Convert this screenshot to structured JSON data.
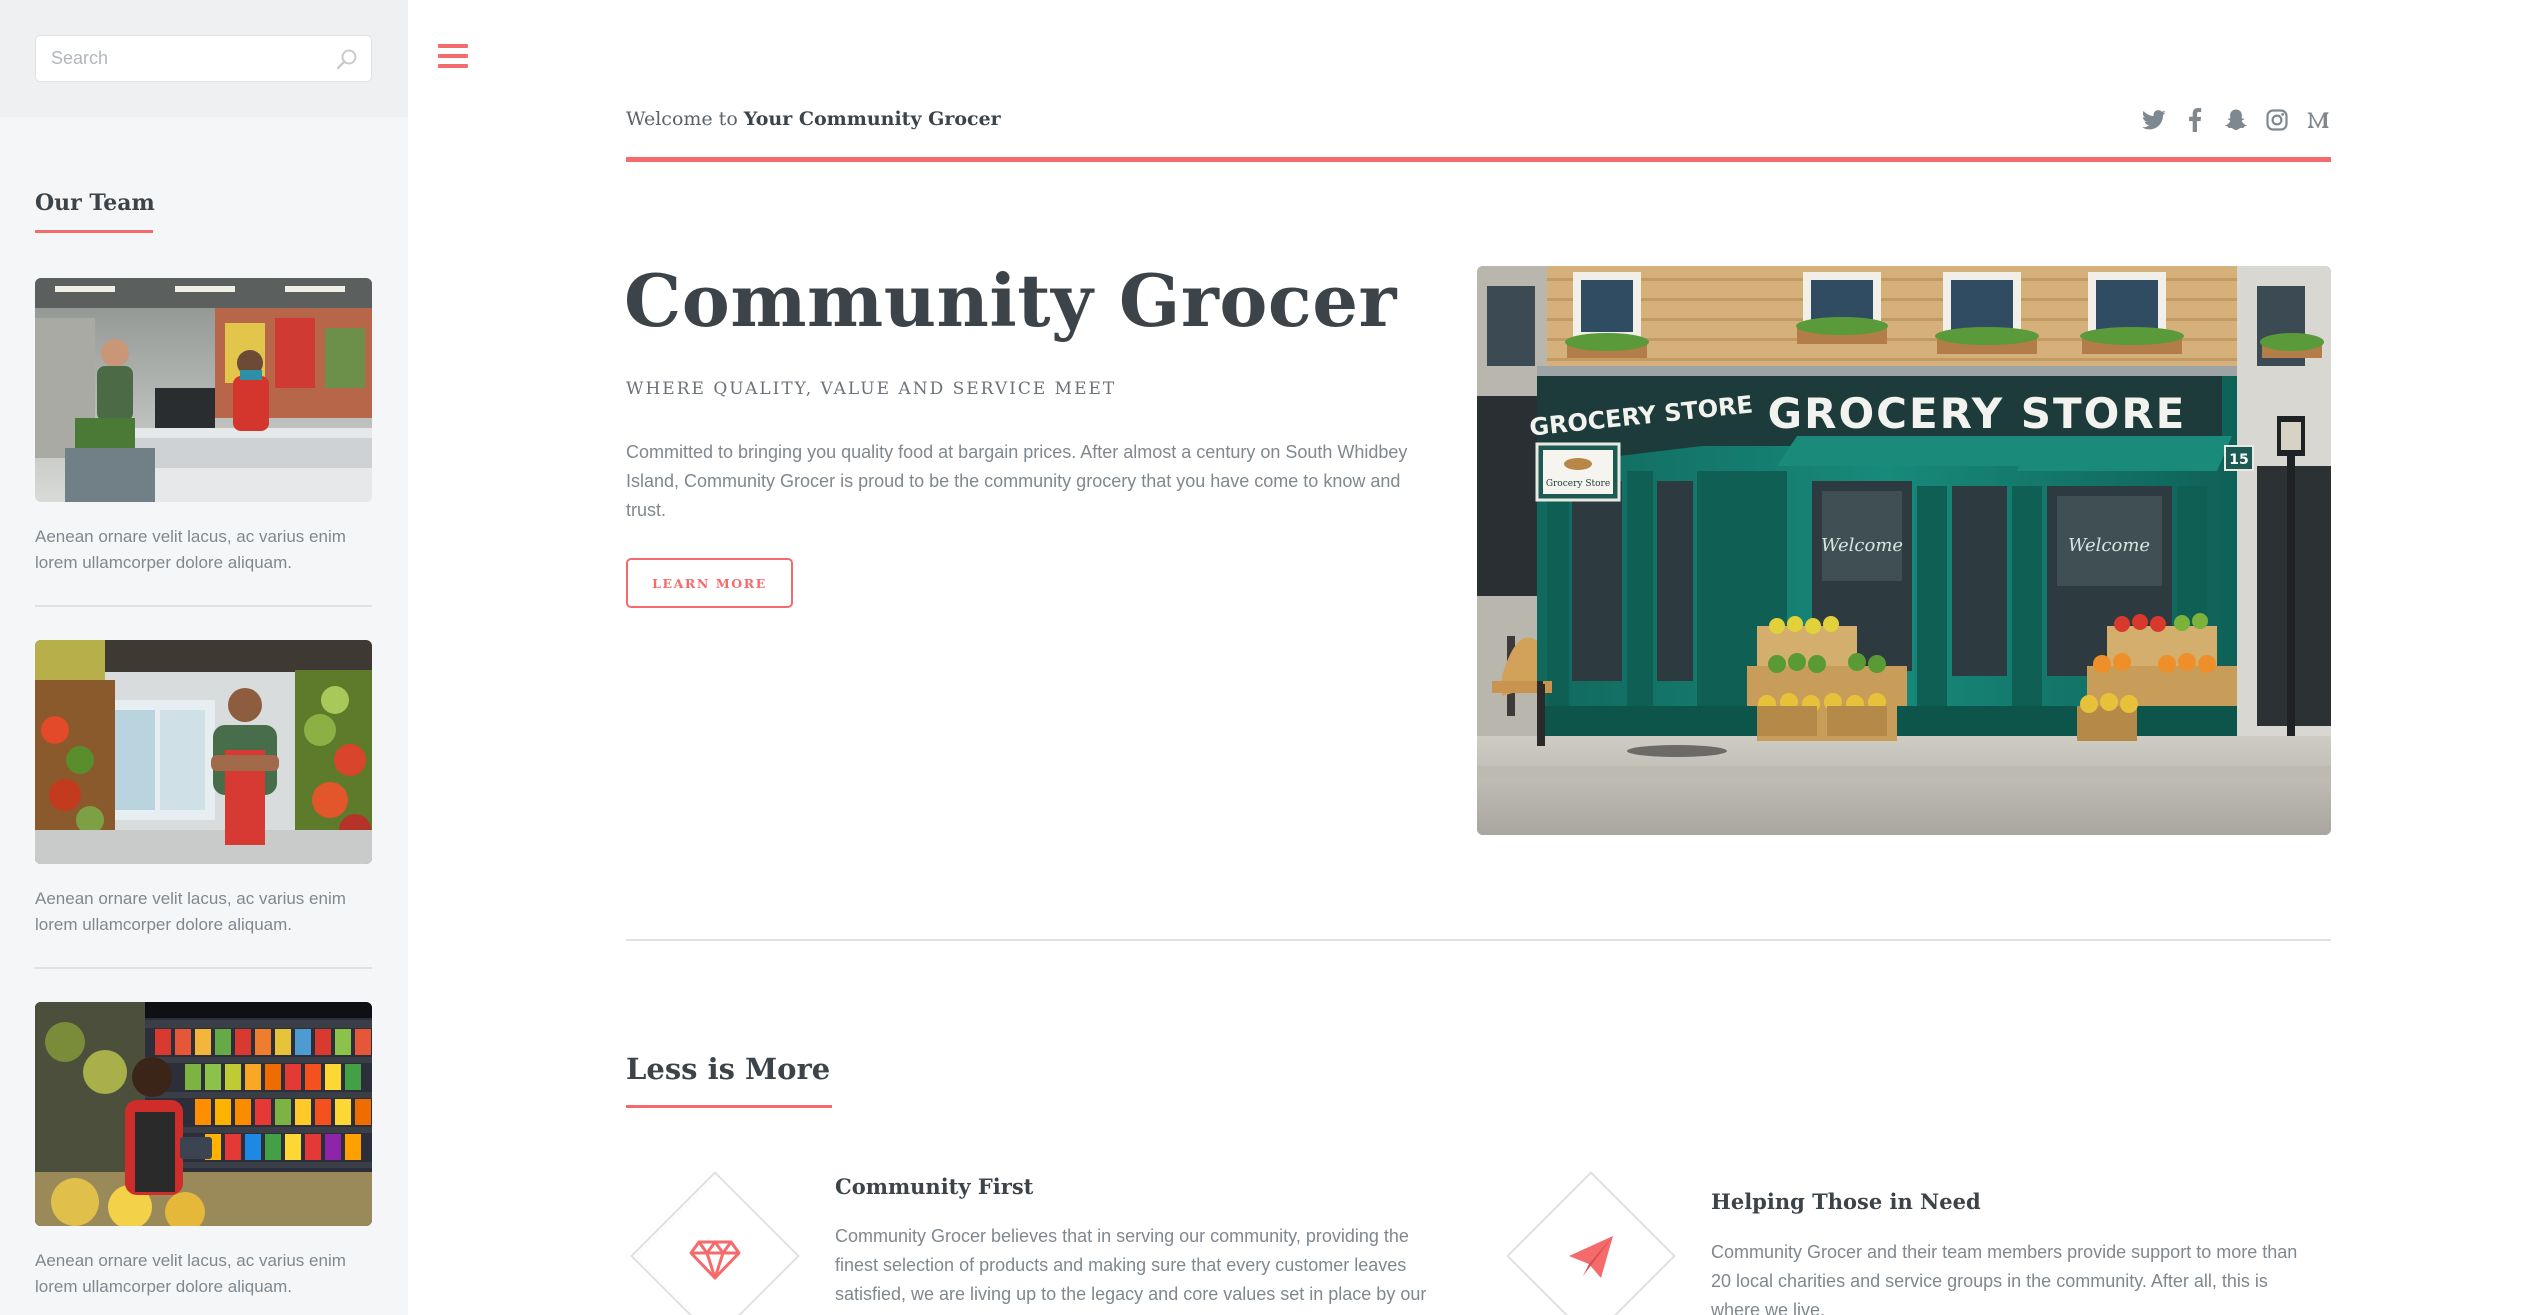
{
  "search": {
    "placeholder": "Search"
  },
  "sidebar": {
    "team_heading": "Our Team",
    "members": [
      {
        "text": "Aenean ornare velit lacus, ac varius enim lorem ullamcorper dolore aliquam."
      },
      {
        "text": "Aenean ornare velit lacus, ac varius enim lorem ullamcorper dolore aliquam."
      },
      {
        "text": "Aenean ornare velit lacus, ac varius enim lorem ullamcorper dolore aliquam."
      }
    ]
  },
  "header": {
    "welcome_prefix": "Welcome to ",
    "welcome_brand": "Your Community Grocer",
    "social": [
      "twitter-icon",
      "facebook-icon",
      "snapchat-icon",
      "instagram-icon",
      "medium-icon"
    ]
  },
  "hero": {
    "title": "Community Grocer",
    "subtitle": "WHERE QUALITY, VALUE AND SERVICE MEET",
    "body": "Committed to bringing you quality food at bargain prices. After almost a century on South Whidbey Island, Community Grocer is proud to be the community grocery that you have come to know and trust.",
    "button": "LEARN MORE",
    "image": {
      "store_sign": "GROCERY STORE",
      "small_sign": "GROCERY STORE",
      "hanging_sign": "Grocery Store",
      "number": "15",
      "window_text": "Welcome"
    }
  },
  "section": {
    "heading": "Less is More",
    "features": [
      {
        "icon": "diamond-icon",
        "title": "Community First",
        "body": "Community Grocer believes that in serving our community, providing the finest selection of products and making sure that every customer leaves satisfied, we are living up to the legacy and core values set in place by our"
      },
      {
        "icon": "paper-plane-icon",
        "title": "Helping Those in Need",
        "body": "Community Grocer and their team members provide support to more than 20 local charities and service groups in the community. After all, this is where we live."
      }
    ]
  },
  "colors": {
    "accent": "#f56a6a",
    "text": "#3d4449",
    "muted": "#7f888f",
    "sidebar_bg": "#f5f6f7"
  }
}
